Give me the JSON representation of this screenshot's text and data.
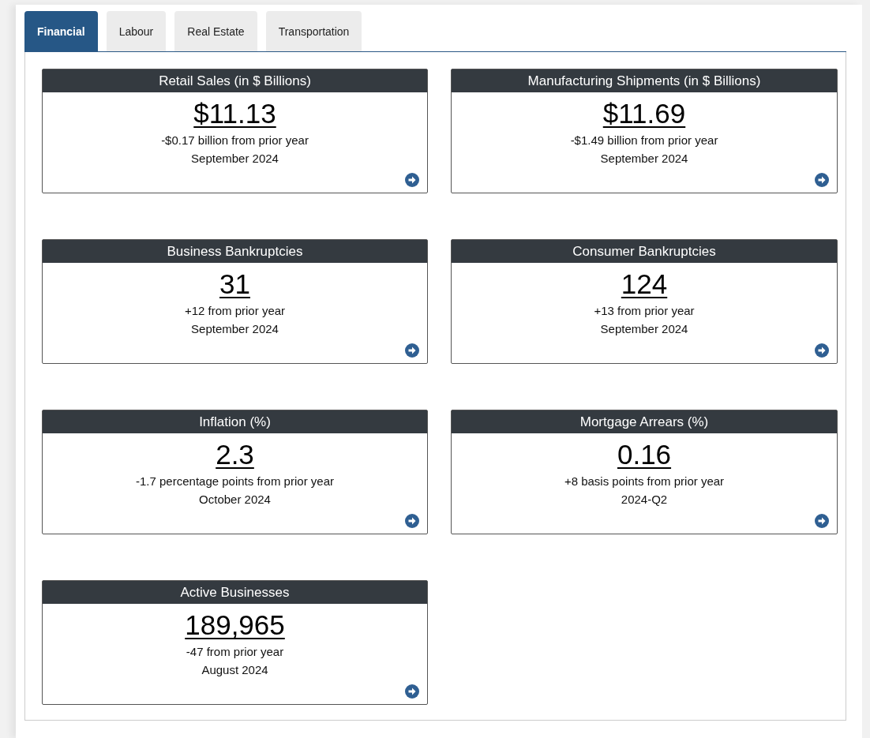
{
  "tabs": [
    {
      "label": "Financial",
      "selected": true
    },
    {
      "label": "Labour",
      "selected": false
    },
    {
      "label": "Real Estate",
      "selected": false
    },
    {
      "label": "Transportation",
      "selected": false
    }
  ],
  "cards": [
    {
      "title": "Retail Sales (in $ Billions)",
      "value": "$11.13",
      "change": "-$0.17 billion from prior year",
      "period": "September 2024"
    },
    {
      "title": "Manufacturing Shipments (in $ Billions)",
      "value": "$11.69",
      "change": "-$1.49 billion from prior year",
      "period": "September 2024"
    },
    {
      "title": "Business Bankruptcies",
      "value": "31",
      "change": "+12 from prior year",
      "period": "September 2024"
    },
    {
      "title": "Consumer Bankruptcies",
      "value": "124",
      "change": "+13 from prior year",
      "period": "September 2024"
    },
    {
      "title": "Inflation (%)",
      "value": "2.3",
      "change": "-1.7 percentage points from prior year",
      "period": "October 2024"
    },
    {
      "title": "Mortgage Arrears (%)",
      "value": "0.16",
      "change": "+8 basis points from prior year",
      "period": "2024-Q2"
    },
    {
      "title": "Active Businesses",
      "value": "189,965",
      "change": "-47 from prior year",
      "period": "August 2024"
    }
  ]
}
